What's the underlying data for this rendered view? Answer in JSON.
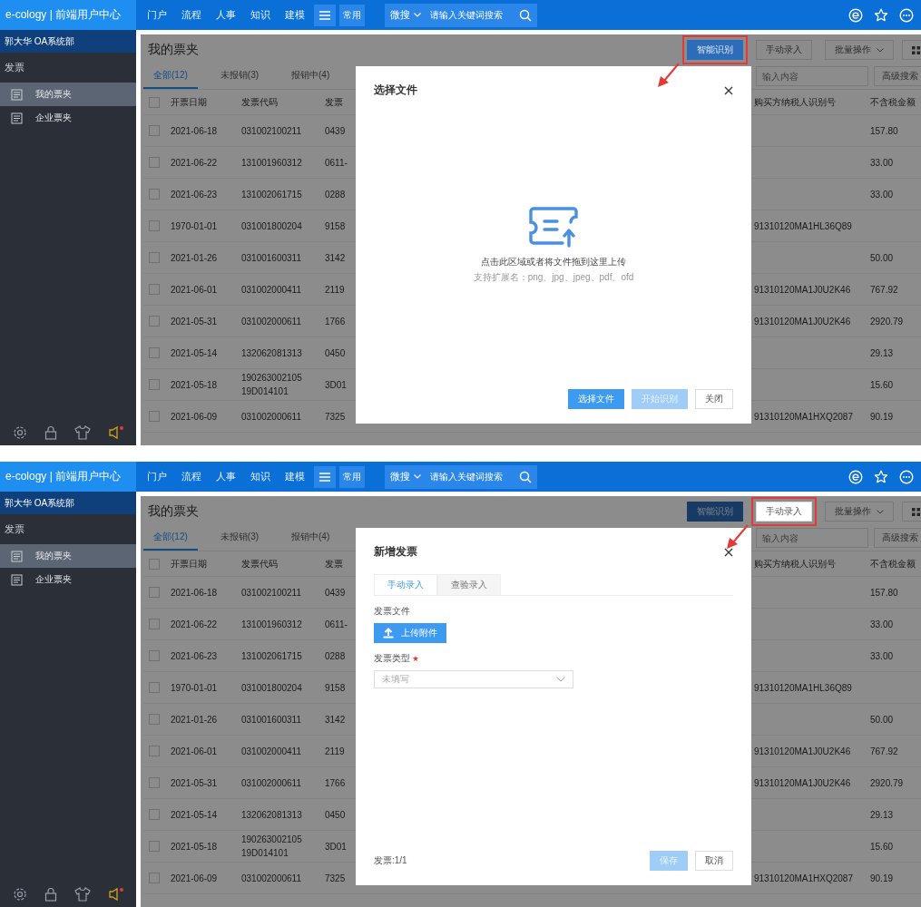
{
  "panels": [
    {
      "top_bar": {
        "logo": "e-cology | 前端用户中心",
        "nav": [
          "门户",
          "流程",
          "人事",
          "知识",
          "建模"
        ],
        "frequent": "常用",
        "search_scope": "微搜",
        "search_placeholder": "请输入关键词搜索"
      },
      "sidebar": {
        "user": "郭大华 OA系统部",
        "section": "发票",
        "items": [
          {
            "label": "我的票夹",
            "selected": true
          },
          {
            "label": "企业票夹",
            "selected": false
          }
        ]
      },
      "page": {
        "title": "我的票夹",
        "actions": [
          {
            "label": "智能识别",
            "primary": true,
            "highlighted": true
          },
          {
            "label": "手动录入",
            "primary": false,
            "highlighted": false
          },
          {
            "label": "批量操作",
            "primary": false,
            "highlighted": false
          }
        ],
        "tabs": [
          {
            "label": "全部(12)",
            "selected": true
          },
          {
            "label": "未报销(3)",
            "selected": false
          },
          {
            "label": "报销中(4)",
            "selected": false
          }
        ],
        "search_placeholder": "输入内容",
        "advanced_search": "高级搜索",
        "table": {
          "columns": [
            "开票日期",
            "发票代码",
            "发票",
            "购买方纳税人识别号",
            "不含税金额"
          ],
          "all_checked": false,
          "rows": [
            {
              "checked": false,
              "cells": [
                "2021-06-18",
                "031002100211",
                "0439",
                "",
                "157.80"
              ]
            },
            {
              "checked": false,
              "cells": [
                "2021-06-22",
                "131001960312",
                "0611-",
                "",
                "33.00"
              ]
            },
            {
              "checked": false,
              "cells": [
                "2021-06-23",
                "131002061715",
                "0288",
                "",
                "33.00"
              ]
            },
            {
              "checked": false,
              "cells": [
                "1970-01-01",
                "031001800204",
                "9158",
                "91310120MA1HL36Q89",
                ""
              ]
            },
            {
              "checked": false,
              "cells": [
                "2021-01-26",
                "031001600311",
                "3142",
                "",
                "50.00"
              ]
            },
            {
              "checked": false,
              "cells": [
                "2021-06-01",
                "031002000411",
                "2119",
                "91310120MA1J0U2K46",
                "767.92"
              ]
            },
            {
              "checked": false,
              "cells": [
                "2021-05-31",
                "031002000611",
                "1766",
                "91310120MA1J0U2K46",
                "2920.79"
              ]
            },
            {
              "checked": false,
              "cells": [
                "2021-05-14",
                "132062081313",
                "0450",
                "",
                "29.13"
              ]
            },
            {
              "checked": false,
              "cells": [
                "2021-05-18",
                "19026300210519D014101",
                "3D01",
                "",
                "15.60"
              ]
            },
            {
              "checked": false,
              "cells": [
                "2021-06-09",
                "031002000611",
                "7325",
                "91310120MA1HXQ2087",
                "90.19"
              ]
            }
          ]
        }
      },
      "dialog": {
        "kind": "upload",
        "title": "选择文件",
        "prompt": "点击此区域或者将文件拖到这里上传",
        "hint": "支持扩展名：png、jpg、jpeg、pdf、ofd",
        "buttons": [
          {
            "label": "选择文件",
            "primary": true,
            "disabled": false
          },
          {
            "label": "开始识别",
            "primary": true,
            "disabled": true
          },
          {
            "label": "关闭",
            "primary": false,
            "disabled": false
          }
        ]
      }
    },
    {
      "top_bar": {
        "logo": "e-cology | 前端用户中心",
        "nav": [
          "门户",
          "流程",
          "人事",
          "知识",
          "建模"
        ],
        "frequent": "常用",
        "search_scope": "微搜",
        "search_placeholder": "请输入关键词搜索"
      },
      "sidebar": {
        "user": "郭大华 OA系统部",
        "section": "发票",
        "items": [
          {
            "label": "我的票夹",
            "selected": true
          },
          {
            "label": "企业票夹",
            "selected": false
          }
        ]
      },
      "page": {
        "title": "我的票夹",
        "actions": [
          {
            "label": "智能识别",
            "primary": true,
            "highlighted": false
          },
          {
            "label": "手动录入",
            "primary": false,
            "highlighted": true
          },
          {
            "label": "批量操作",
            "primary": false,
            "highlighted": false
          }
        ],
        "tabs": [
          {
            "label": "全部(12)",
            "selected": true
          },
          {
            "label": "未报销(3)",
            "selected": false
          },
          {
            "label": "报销中(4)",
            "selected": false
          }
        ],
        "search_placeholder": "输入内容",
        "advanced_search": "高级搜索",
        "table": {
          "columns": [
            "开票日期",
            "发票代码",
            "发票",
            "购买方纳税人识别号",
            "不含税金额"
          ],
          "all_checked": false,
          "rows": [
            {
              "checked": false,
              "cells": [
                "2021-06-18",
                "031002100211",
                "0439",
                "",
                "157.80"
              ]
            },
            {
              "checked": false,
              "cells": [
                "2021-06-22",
                "131001960312",
                "0611-",
                "",
                "33.00"
              ]
            },
            {
              "checked": false,
              "cells": [
                "2021-06-23",
                "131002061715",
                "0288",
                "",
                "33.00"
              ]
            },
            {
              "checked": false,
              "cells": [
                "1970-01-01",
                "031001800204",
                "9158",
                "91310120MA1HL36Q89",
                ""
              ]
            },
            {
              "checked": false,
              "cells": [
                "2021-01-26",
                "031001600311",
                "3142",
                "",
                "50.00"
              ]
            },
            {
              "checked": false,
              "cells": [
                "2021-06-01",
                "031002000411",
                "2119",
                "91310120MA1J0U2K46",
                "767.92"
              ]
            },
            {
              "checked": false,
              "cells": [
                "2021-05-31",
                "031002000611",
                "1766",
                "91310120MA1J0U2K46",
                "2920.79"
              ]
            },
            {
              "checked": false,
              "cells": [
                "2021-05-14",
                "132062081313",
                "0450",
                "",
                "29.13"
              ]
            },
            {
              "checked": false,
              "cells": [
                "2021-05-18",
                "19026300210519D014101",
                "3D01",
                "",
                "15.60"
              ]
            },
            {
              "checked": false,
              "cells": [
                "2021-06-09",
                "031002000611",
                "7325",
                "91310120MA1HXQ2087",
                "90.19"
              ]
            }
          ]
        }
      },
      "dialog": {
        "kind": "form",
        "title": "新增发票",
        "tabs": [
          {
            "label": "手动录入",
            "selected": true
          },
          {
            "label": "查验录入",
            "selected": false
          }
        ],
        "fields": [
          {
            "kind": "upload",
            "label": "发票文件",
            "button": "上传附件",
            "required": false
          },
          {
            "kind": "select",
            "label": "发票类型",
            "placeholder": "未填写",
            "required": true
          }
        ],
        "footer_note": "发票:1/1",
        "buttons": [
          {
            "label": "保存",
            "primary": true,
            "disabled": true
          },
          {
            "label": "取消",
            "primary": false,
            "disabled": false
          }
        ]
      }
    }
  ]
}
